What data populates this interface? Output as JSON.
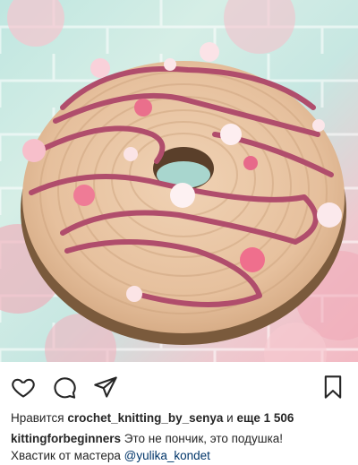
{
  "likes": {
    "prefix": "Нравится ",
    "user": "crochet_knitting_by_senya",
    "middle": " и ",
    "count_text": "еще 1 506"
  },
  "caption": {
    "author": "kittingforbeginners",
    "text": " Это не пончик, это подушка!",
    "line2_prefix": "Хвастик от мастера ",
    "mention": "@yulika_kondet"
  },
  "icons": {
    "like": "heart-icon",
    "comment": "comment-icon",
    "share": "paper-plane-icon",
    "save": "bookmark-icon"
  },
  "colors": {
    "text": "#262626",
    "link": "#003569",
    "donut_base": "#e9c5a4",
    "donut_stripe": "#b04d6c"
  }
}
